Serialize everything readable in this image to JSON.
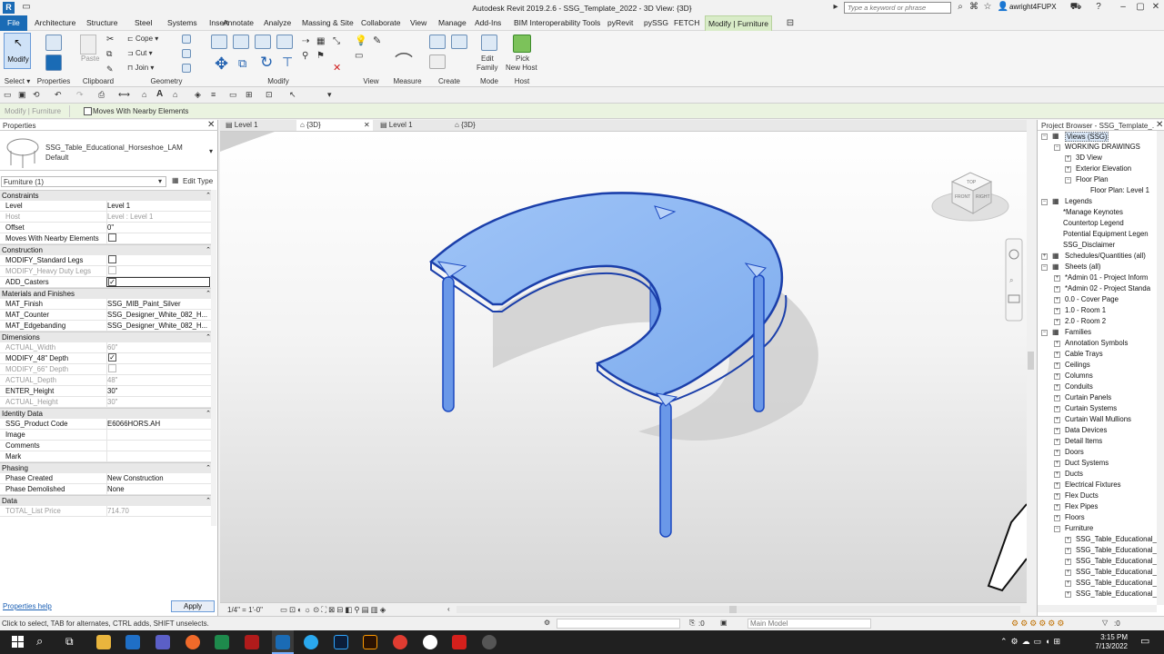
{
  "window": {
    "title": "Autodesk Revit 2019.2.6 - SSG_Template_2022 - 3D View: {3D}",
    "search_placeholder": "Type a keyword or phrase",
    "user": "awright4FUPX"
  },
  "menu": {
    "file": "File",
    "tabs": [
      "Architecture",
      "Structure",
      "Steel",
      "Systems",
      "Insert",
      "Annotate",
      "Analyze",
      "Massing & Site",
      "Collaborate",
      "View",
      "Manage",
      "Add-Ins",
      "BIM Interoperability Tools",
      "pyRevit",
      "pySSG",
      "FETCH",
      "Modify | Furniture"
    ]
  },
  "ribbon": {
    "modify": "Modify",
    "select": "Select",
    "properties": "Properties",
    "paste": "Paste",
    "clipboard": "Clipboard",
    "cope": "Cope",
    "cut": "Cut",
    "join": "Join",
    "geometry": "Geometry",
    "modify_group": "Modify",
    "view": "View",
    "measure": "Measure",
    "create": "Create",
    "edit_family_1": "Edit",
    "edit_family_2": "Family",
    "mode": "Mode",
    "pick_host_1": "Pick",
    "pick_host_2": "New Host",
    "host": "Host"
  },
  "options": {
    "context": "Modify | Furniture",
    "moves_with_nearby": "Moves With Nearby Elements"
  },
  "properties": {
    "title": "Properties",
    "family_name": "SSG_Table_Educational_Horseshoe_LAM",
    "family_type": "Default",
    "selector": "Furniture (1)",
    "edit_type": "Edit Type",
    "help": "Properties help",
    "apply": "Apply",
    "sections": [
      {
        "name": "Constraints",
        "rows": [
          {
            "k": "Level",
            "v": "Level 1"
          },
          {
            "k": "Host",
            "v": "Level : Level 1",
            "dis": true
          },
          {
            "k": "Offset",
            "v": "0\""
          },
          {
            "k": "Moves With Nearby Elements",
            "cb": "off"
          }
        ]
      },
      {
        "name": "Construction",
        "rows": [
          {
            "k": "MODIFY_Standard Legs",
            "cb": "off"
          },
          {
            "k": "MODIFY_Heavy Duty Legs",
            "cb": "dis",
            "dis": true
          },
          {
            "k": "ADD_Casters",
            "cb": "on",
            "sel": true
          }
        ]
      },
      {
        "name": "Materials and Finishes",
        "rows": [
          {
            "k": "MAT_Finish",
            "v": "SSG_MIB_Paint_Silver"
          },
          {
            "k": "MAT_Counter",
            "v": "SSG_Designer_White_082_H..."
          },
          {
            "k": "MAT_Edgebanding",
            "v": "SSG_Designer_White_082_H..."
          }
        ]
      },
      {
        "name": "Dimensions",
        "rows": [
          {
            "k": "ACTUAL_Width",
            "v": "60\"",
            "dis": true
          },
          {
            "k": "MODIFY_48\" Depth",
            "cb": "on"
          },
          {
            "k": "MODIFY_66\" Depth",
            "cb": "dis",
            "dis": true
          },
          {
            "k": "ACTUAL_Depth",
            "v": "48\"",
            "dis": true
          },
          {
            "k": "ENTER_Height",
            "v": "30\""
          },
          {
            "k": "ACTUAL_Height",
            "v": "30\"",
            "dis": true
          }
        ]
      },
      {
        "name": "Identity Data",
        "rows": [
          {
            "k": "SSG_Product Code",
            "v": "E6066HORS.AH"
          },
          {
            "k": "Image",
            "v": ""
          },
          {
            "k": "Comments",
            "v": ""
          },
          {
            "k": "Mark",
            "v": ""
          }
        ]
      },
      {
        "name": "Phasing",
        "rows": [
          {
            "k": "Phase Created",
            "v": "New Construction"
          },
          {
            "k": "Phase Demolished",
            "v": "None"
          }
        ]
      },
      {
        "name": "Data",
        "rows": [
          {
            "k": "TOTAL_List Price",
            "v": "714.70",
            "dis": true
          }
        ]
      }
    ]
  },
  "view_tabs": [
    "Level 1",
    "{3D}",
    "Level 1",
    "{3D}"
  ],
  "viewcube": {
    "top": "TOP",
    "front": "FRONT",
    "right": "RIGHT"
  },
  "view_control": {
    "scale": "1/4\" = 1'-0\""
  },
  "browser": {
    "title": "Project Browser - SSG_Template_...",
    "nodes": [
      {
        "t": "Views (SSG)",
        "l": 0,
        "ex": "-",
        "hl": true
      },
      {
        "t": "WORKING DRAWINGS",
        "l": 1,
        "ex": "-"
      },
      {
        "t": "3D View",
        "l": 2,
        "ex": "+"
      },
      {
        "t": "Exterior Elevation",
        "l": 2,
        "ex": "+"
      },
      {
        "t": "Floor Plan",
        "l": 2,
        "ex": "-"
      },
      {
        "t": "Floor Plan: Level 1",
        "l": 3
      },
      {
        "t": "Legends",
        "l": 0,
        "ex": "-"
      },
      {
        "t": "*Manage Keynotes",
        "l": 1
      },
      {
        "t": "Countertop Legend",
        "l": 1
      },
      {
        "t": "Potential Equipment Legen",
        "l": 1
      },
      {
        "t": "SSG_Disclaimer",
        "l": 1
      },
      {
        "t": "Schedules/Quantities (all)",
        "l": 0,
        "ex": "+"
      },
      {
        "t": "Sheets (all)",
        "l": 0,
        "ex": "-"
      },
      {
        "t": "*Admin 01 - Project Inform",
        "l": 1,
        "ex": "+"
      },
      {
        "t": "*Admin 02 - Project Standa",
        "l": 1,
        "ex": "+"
      },
      {
        "t": "0.0 - Cover Page",
        "l": 1,
        "ex": "+"
      },
      {
        "t": "1.0 - Room 1",
        "l": 1,
        "ex": "+"
      },
      {
        "t": "2.0 - Room 2",
        "l": 1,
        "ex": "+"
      },
      {
        "t": "Families",
        "l": 0,
        "ex": "-"
      },
      {
        "t": "Annotation Symbols",
        "l": 1,
        "ex": "+"
      },
      {
        "t": "Cable Trays",
        "l": 1,
        "ex": "+"
      },
      {
        "t": "Ceilings",
        "l": 1,
        "ex": "+"
      },
      {
        "t": "Columns",
        "l": 1,
        "ex": "+"
      },
      {
        "t": "Conduits",
        "l": 1,
        "ex": "+"
      },
      {
        "t": "Curtain Panels",
        "l": 1,
        "ex": "+"
      },
      {
        "t": "Curtain Systems",
        "l": 1,
        "ex": "+"
      },
      {
        "t": "Curtain Wall Mullions",
        "l": 1,
        "ex": "+"
      },
      {
        "t": "Data Devices",
        "l": 1,
        "ex": "+"
      },
      {
        "t": "Detail Items",
        "l": 1,
        "ex": "+"
      },
      {
        "t": "Doors",
        "l": 1,
        "ex": "+"
      },
      {
        "t": "Duct Systems",
        "l": 1,
        "ex": "+"
      },
      {
        "t": "Ducts",
        "l": 1,
        "ex": "+"
      },
      {
        "t": "Electrical Fixtures",
        "l": 1,
        "ex": "+"
      },
      {
        "t": "Flex Ducts",
        "l": 1,
        "ex": "+"
      },
      {
        "t": "Flex Pipes",
        "l": 1,
        "ex": "+"
      },
      {
        "t": "Floors",
        "l": 1,
        "ex": "+"
      },
      {
        "t": "Furniture",
        "l": 1,
        "ex": "-"
      },
      {
        "t": "SSG_Table_Educational_",
        "l": 2,
        "ex": "+"
      },
      {
        "t": "SSG_Table_Educational_",
        "l": 2,
        "ex": "+"
      },
      {
        "t": "SSG_Table_Educational_",
        "l": 2,
        "ex": "+"
      },
      {
        "t": "SSG_Table_Educational_",
        "l": 2,
        "ex": "+"
      },
      {
        "t": "SSG_Table_Educational_",
        "l": 2,
        "ex": "+"
      },
      {
        "t": "SSG_Table_Educational_",
        "l": 2,
        "ex": "+"
      }
    ]
  },
  "status": {
    "hint": "Click to select, TAB for alternates, CTRL adds, SHIFT unselects.",
    "zero": ":0",
    "model": "Main Model"
  },
  "clock": {
    "time": "3:15 PM",
    "date": "7/13/2022"
  },
  "colors": {
    "accent": "#1a6bb5",
    "contextual_tab": "#d9ecc8",
    "selection": "#2d5fd0"
  }
}
